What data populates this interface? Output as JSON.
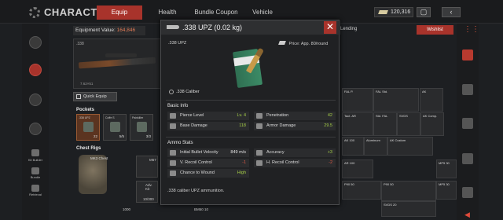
{
  "header": {
    "title": "CHARACTER",
    "tabs": [
      {
        "label": "Equip",
        "active": true
      },
      {
        "label": "Health",
        "active": false
      },
      {
        "label": "Bundle Coupon",
        "active": false
      },
      {
        "label": "Vehicle",
        "active": false
      }
    ],
    "currency": "120,316",
    "back_label": "‹",
    "accent": "#a8332b"
  },
  "sidebar": {
    "items": [
      {
        "label": "",
        "icon": "equipment-icon"
      },
      {
        "label": "",
        "icon": "backpack-icon"
      },
      {
        "label": "",
        "icon": "character-icon"
      },
      {
        "label": "",
        "icon": "mail-icon"
      },
      {
        "label": "Kit Builder",
        "icon": "kit-builder-icon"
      },
      {
        "label": "Bundle",
        "icon": "bundle-icon"
      },
      {
        "label": "Retrieval",
        "icon": "retrieval-icon"
      }
    ]
  },
  "equipment": {
    "value_label": "Equipment Value:",
    "value": "164,846",
    "weapon_caliber": ".338",
    "weapon_round": "7.62×51",
    "quick_equip": "Quick Equip",
    "pockets_label": "Pockets",
    "pockets": [
      {
        "label": ".338 UPZ",
        "count": "22"
      },
      {
        "label": "Coffe S",
        "count": "5/5"
      },
      {
        "label": "Painkiller",
        "count": "3/3"
      }
    ],
    "chest_rigs_label": "Chest Rigs",
    "rig_name": "MK3 Chest",
    "rig_items": [
      {
        "label": "M67",
        "count": ""
      },
      {
        "label": "Adv. Kit",
        "count": "10/300"
      }
    ],
    "bottom_values": [
      "1000",
      "BM50 10"
    ]
  },
  "right_panel": {
    "title": "Lending",
    "wishlist": "Wishlist",
    "cells": [
      {
        "label": "FAL P.",
        "value": ""
      },
      {
        "label": "FAL Std.",
        "value": ""
      },
      {
        "label": "AK",
        "value": ""
      },
      {
        "label": "Tact. AR",
        "value": ""
      },
      {
        "label": "Std. FAL",
        "value": ""
      },
      {
        "label": "SVDS",
        "value": ""
      },
      {
        "label": "AK Comp.",
        "value": ""
      },
      {
        "label": "AK 100",
        "value": ""
      },
      {
        "label": "Aluminum",
        "value": ""
      },
      {
        "label": "AK Custom",
        "value": ""
      },
      {
        "label": "AR 100",
        "value": ""
      },
      {
        "label": "P90 50",
        "value": ""
      },
      {
        "label": "MP5 30",
        "value": ""
      },
      {
        "label": "P90 50",
        "value": ""
      },
      {
        "label": "MP5 30",
        "value": ""
      },
      {
        "label": "SVDS 20",
        "value": ""
      }
    ]
  },
  "popup": {
    "title": ".338 UPZ (0.02 kg)",
    "item_name": ".338 UPZ",
    "price": "Price: App. 80/round",
    "caliber": ".338 Caliber",
    "close_label": "✕",
    "basic_info_label": "Basic Info",
    "basic_stats": [
      {
        "label": "Pierce Level",
        "value": "Lv. 4",
        "color": "green"
      },
      {
        "label": "Penetration",
        "value": "42",
        "color": "green"
      },
      {
        "label": "Base Damage",
        "value": "118",
        "color": "green"
      },
      {
        "label": "Armor Damage",
        "value": "29.5",
        "color": "green"
      }
    ],
    "ammo_stats_label": "Ammo Stats",
    "ammo_stats": [
      {
        "label": "Initial Bullet Velocity",
        "value": "849 m/s",
        "color": "white"
      },
      {
        "label": "Accuracy",
        "value": "+3",
        "color": "green"
      },
      {
        "label": "V. Recoil Control",
        "value": "-1",
        "color": "red"
      },
      {
        "label": "H. Recoil Control",
        "value": "-2",
        "color": "red"
      },
      {
        "label": "Chance to Wound",
        "value": "High",
        "color": "green"
      }
    ],
    "description": ".338 caliber UPZ ammunition."
  }
}
